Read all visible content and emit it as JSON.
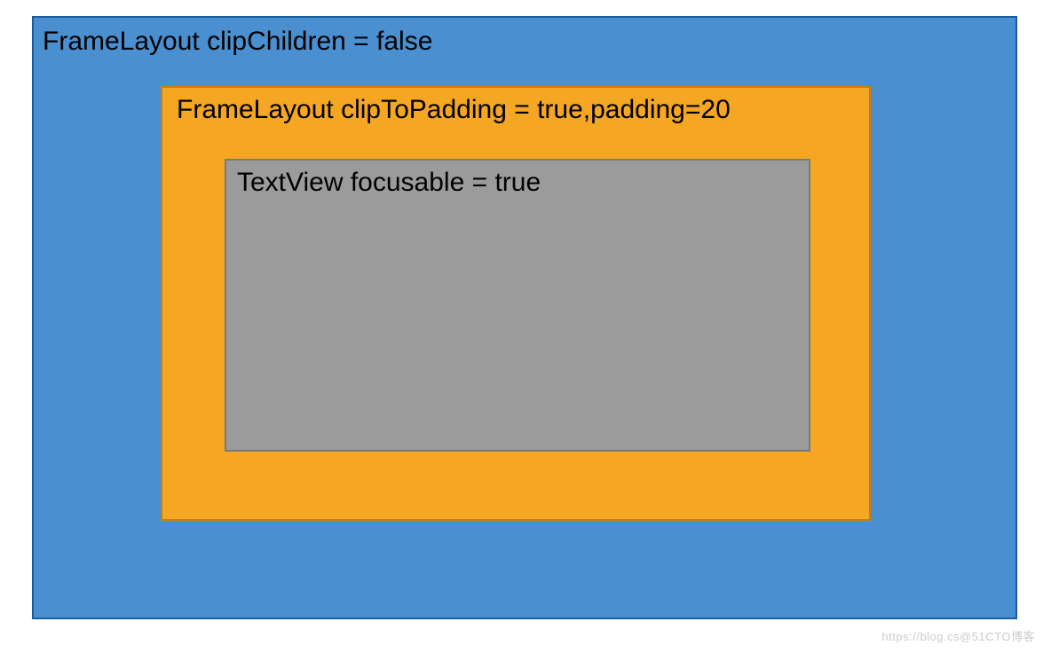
{
  "diagram": {
    "outer": {
      "label": "FrameLayout  clipChildren = false",
      "component": "FrameLayout",
      "property": "clipChildren",
      "value": "false",
      "color": "#4a8fd0"
    },
    "middle": {
      "label": "FrameLayout  clipToPadding = true,padding=20",
      "component": "FrameLayout",
      "property1": "clipToPadding",
      "value1": "true",
      "property2": "padding",
      "value2": "20",
      "color": "#f5a623"
    },
    "inner": {
      "label": "TextView  focusable = true",
      "component": "TextView",
      "property": "focusable",
      "value": "true",
      "color": "#9b9b9b"
    }
  },
  "watermark": "https://blog.cs@51CTO博客"
}
